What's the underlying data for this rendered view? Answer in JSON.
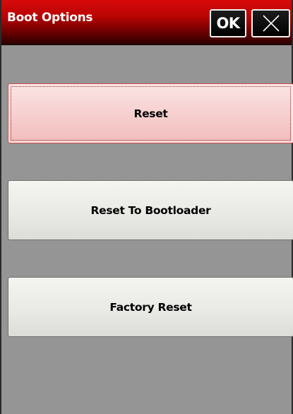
{
  "window": {
    "title": "Boot Options"
  },
  "titlebar": {
    "ok_label": "OK",
    "close_icon": "close-icon"
  },
  "options": [
    {
      "label": "Reset",
      "selected": true
    },
    {
      "label": "Reset To Bootloader",
      "selected": false
    },
    {
      "label": "Factory Reset",
      "selected": false
    }
  ],
  "colors": {
    "titlebar_red": "#d80a0a",
    "background": "#959595",
    "selected_fill": "#f6cccc"
  }
}
